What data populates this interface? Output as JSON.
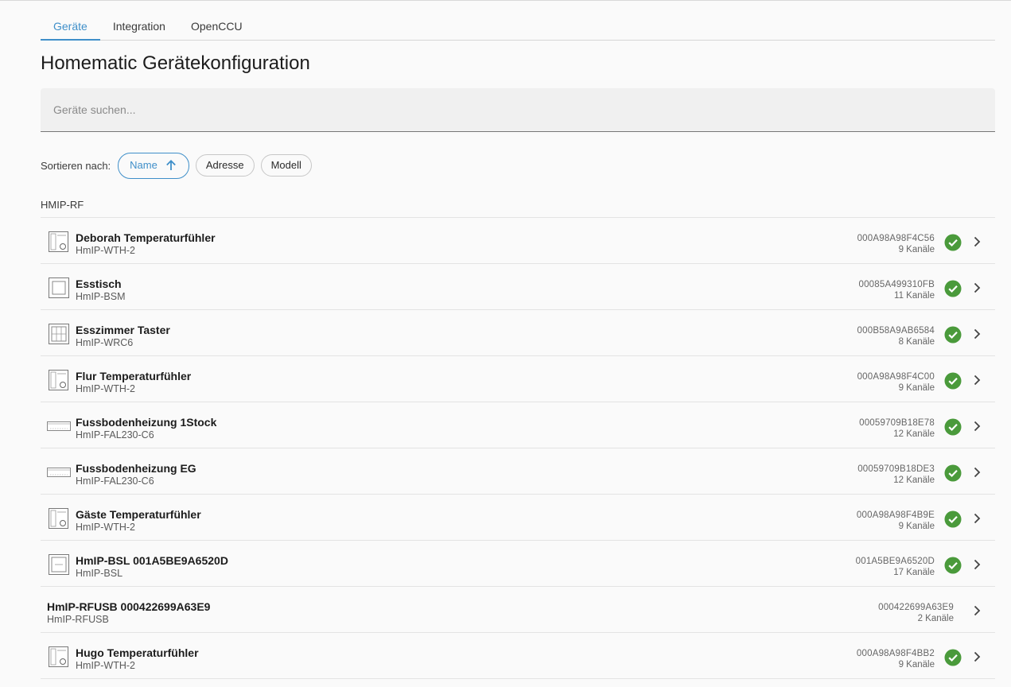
{
  "tabs": [
    {
      "label": "Geräte",
      "active": true
    },
    {
      "label": "Integration",
      "active": false
    },
    {
      "label": "OpenCCU",
      "active": false
    }
  ],
  "page_title": "Homematic Gerätekonfiguration",
  "search": {
    "placeholder": "Geräte suchen...",
    "value": ""
  },
  "sort": {
    "label": "Sortieren nach:",
    "options": [
      {
        "label": "Name",
        "active": true,
        "direction_icon": "arrow-up-icon"
      },
      {
        "label": "Adresse",
        "active": false
      },
      {
        "label": "Modell",
        "active": false
      }
    ]
  },
  "group_label": "HMIP-RF",
  "colors": {
    "accent": "#3f8fc9",
    "status_ok": "#4a9a3b"
  },
  "devices": [
    {
      "name": "Deborah Temperaturfühler",
      "model": "HmIP-WTH-2",
      "address": "000A98A98F4C56",
      "channels": "9 Kanäle",
      "icon": "thermostat-icon",
      "status": "ok"
    },
    {
      "name": "Esstisch",
      "model": "HmIP-BSM",
      "address": "00085A499310FB",
      "channels": "11 Kanäle",
      "icon": "wall-switch-icon",
      "status": "ok"
    },
    {
      "name": "Esszimmer Taster",
      "model": "HmIP-WRC6",
      "address": "000B58A9AB6584",
      "channels": "8 Kanäle",
      "icon": "remote-6-button-icon",
      "status": "ok"
    },
    {
      "name": "Flur Temperaturfühler",
      "model": "HmIP-WTH-2",
      "address": "000A98A98F4C00",
      "channels": "9 Kanäle",
      "icon": "thermostat-icon",
      "status": "ok"
    },
    {
      "name": "Fussbodenheizung 1Stock",
      "model": "HmIP-FAL230-C6",
      "address": "00059709B18E78",
      "channels": "12 Kanäle",
      "icon": "floor-heating-actuator-icon",
      "status": "ok"
    },
    {
      "name": "Fussbodenheizung EG",
      "model": "HmIP-FAL230-C6",
      "address": "00059709B18DE3",
      "channels": "12 Kanäle",
      "icon": "floor-heating-actuator-icon",
      "status": "ok"
    },
    {
      "name": "Gäste Temperaturfühler",
      "model": "HmIP-WTH-2",
      "address": "000A98A98F4B9E",
      "channels": "9 Kanäle",
      "icon": "thermostat-icon",
      "status": "ok"
    },
    {
      "name": "HmIP-BSL 001A5BE9A6520D",
      "model": "HmIP-BSL",
      "address": "001A5BE9A6520D",
      "channels": "17 Kanäle",
      "icon": "switch-actuator-icon",
      "status": "ok"
    },
    {
      "name": "HmIP-RFUSB 000422699A63E9",
      "model": "HmIP-RFUSB",
      "address": "000422699A63E9",
      "channels": "2 Kanäle",
      "icon": "",
      "status": ""
    },
    {
      "name": "Hugo Temperaturfühler",
      "model": "HmIP-WTH-2",
      "address": "000A98A98F4BB2",
      "channels": "9 Kanäle",
      "icon": "thermostat-icon",
      "status": "ok"
    }
  ]
}
